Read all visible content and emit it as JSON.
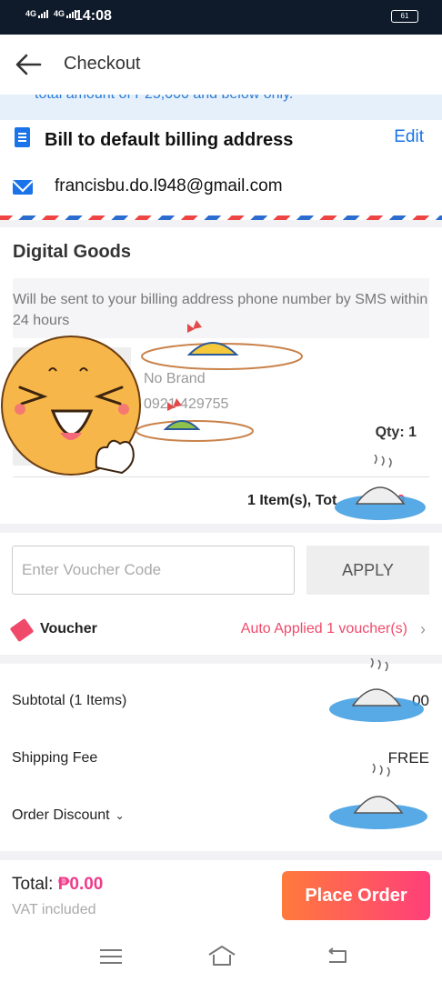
{
  "status_bar": {
    "network1": "4G",
    "network2": "4G",
    "time": "14:08",
    "battery": "61"
  },
  "header": {
    "title": "Checkout"
  },
  "notice": {
    "text": "total amount of ₱25,000 and below only."
  },
  "billing": {
    "title": "Bill to default billing address",
    "edit_label": "Edit",
    "email": "francisbu.do.l948@gmail.com"
  },
  "digital_goods": {
    "title": "Digital Goods",
    "sms_note": "Will be sent to your billing address phone number by SMS within 24 hours",
    "product": {
      "brand": "No Brand",
      "phone": "0921  429755",
      "qty_label": "Qty: 1"
    },
    "items_total": {
      "label": "1 Item(s), Tot",
      "amount": "0"
    }
  },
  "voucher": {
    "input_placeholder": "Enter Voucher Code",
    "apply_label": "APPLY",
    "label": "Voucher",
    "status": "Auto Applied 1 voucher(s)"
  },
  "summary": {
    "subtotal_label": "Subtotal (1 Items)",
    "subtotal_value": "00",
    "shipping_label": "Shipping Fee",
    "shipping_value": "FREE",
    "discount_label": "Order Discount"
  },
  "footer": {
    "total_label": "Total:",
    "total_amount": "₱0.00",
    "vat_label": "VAT included",
    "place_order_label": "Place Order"
  },
  "colors": {
    "accent_blue": "#1a73e8",
    "pink": "#f03a8a",
    "voucher_red": "#f04a6a",
    "button_gradient": [
      "#ff7a3c",
      "#ff3f7a"
    ]
  }
}
